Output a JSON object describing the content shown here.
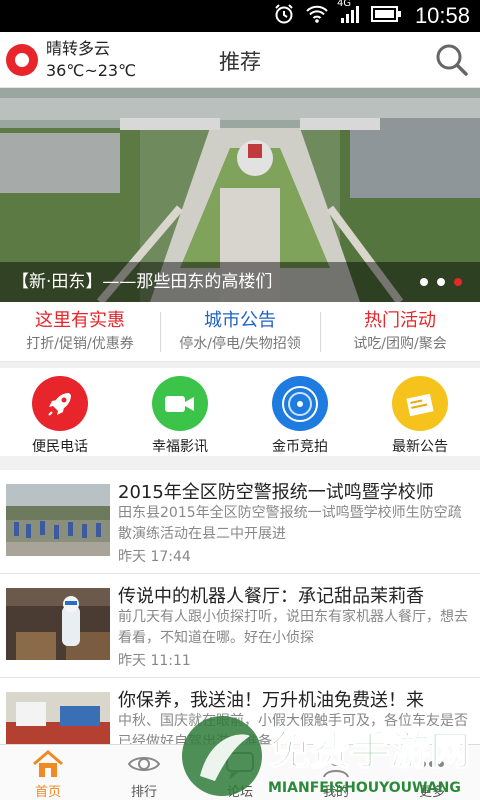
{
  "statusbar": {
    "network": "4G",
    "time": "10:58"
  },
  "header": {
    "weather": {
      "condition": "晴转多云",
      "temperature": "36℃~23℃"
    },
    "title": "推荐",
    "search_icon": "search-icon"
  },
  "banner": {
    "caption": "【新·田东】——那些田东的高楼们",
    "dots_count": 3,
    "active_dot": 3
  },
  "promos": [
    {
      "title": "这里有实惠",
      "subtitle": "打折/促销/优惠券",
      "color": "#e8252a"
    },
    {
      "title": "城市公告",
      "subtitle": "停水/停电/失物招领",
      "color": "#1e63c6"
    },
    {
      "title": "热门活动",
      "subtitle": "试吃/团购/聚会",
      "color": "#e8252a"
    }
  ],
  "quick_links": [
    {
      "label": "便民电话",
      "icon": "rocket-icon",
      "color": "#e8252a"
    },
    {
      "label": "幸福影讯",
      "icon": "video-camera-icon",
      "color": "#3cc34a"
    },
    {
      "label": "金币竞拍",
      "icon": "coin-icon",
      "color": "#1e7be0"
    },
    {
      "label": "最新公告",
      "icon": "notice-icon",
      "color": "#f6c21c"
    }
  ],
  "news": [
    {
      "title": "2015年全区防空警报统一试鸣暨学校师",
      "desc": "田东县2015年全区防空警报统一试鸣暨学校师生防空疏散演练活动在县二中开展进",
      "time": "昨天 17:44"
    },
    {
      "title": "传说中的机器人餐厅：承记甜品茉莉香",
      "desc": "前几天有人跟小侦探打听，说田东有家机器人餐厅，想去看看，不知道在哪。好在小侦探",
      "time": "昨天 11:11"
    },
    {
      "title": "你保养，我送油！万升机油免费送！来",
      "desc": "中秋、国庆就在眼前，小假大假触手可及，各位车友是否已经做好自驾出游的准备",
      "time": ""
    }
  ],
  "tabs": [
    {
      "label": "首页",
      "icon": "home-icon",
      "active": true
    },
    {
      "label": "排行",
      "icon": "eye-icon",
      "active": false
    },
    {
      "label": "论坛",
      "icon": "chat-icon",
      "active": false
    },
    {
      "label": "我的",
      "icon": "user-icon",
      "active": false
    },
    {
      "label": "更多",
      "icon": "more-icon",
      "active": false
    }
  ],
  "watermark": {
    "text": "免费手游网",
    "sub": "MIANFEISHOUYOUWANG"
  },
  "colors": {
    "accent": "#e8252a",
    "tab_active": "#f08a24",
    "blue": "#1e63c6"
  }
}
